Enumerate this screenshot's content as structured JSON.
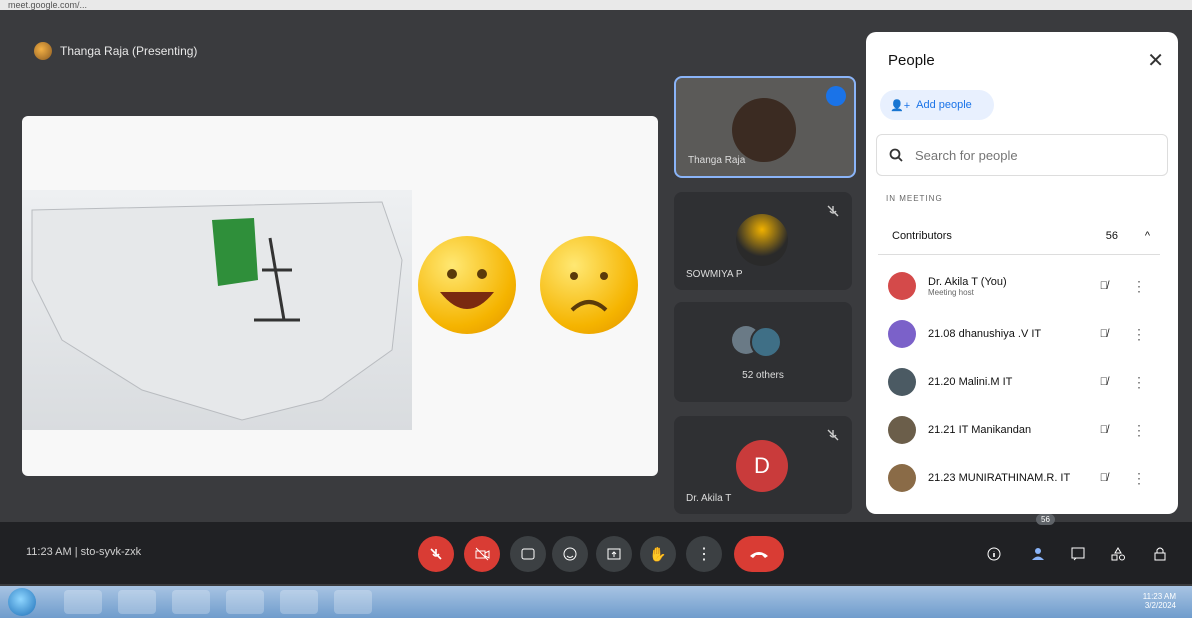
{
  "browser": {
    "url": "meet.google.com/..."
  },
  "meeting": {
    "presenter_label": "Thanga Raja (Presenting)",
    "time": "11:23 AM",
    "code": "sto-syvk-zxk"
  },
  "tiles": [
    {
      "name": "Thanga Raja"
    },
    {
      "name": "SOWMIYA P"
    },
    {
      "name": "52 others"
    },
    {
      "name": "Dr. Akila T",
      "initial": "D"
    }
  ],
  "people_panel": {
    "title": "People",
    "add_label": "Add people",
    "search_placeholder": "Search for people",
    "section_label": "IN MEETING",
    "contributors_label": "Contributors",
    "contributors_count": "56",
    "participants": [
      {
        "name": "Dr. Akila T (You)",
        "sub": "Meeting host",
        "avatar_color": "#d44a4a"
      },
      {
        "name": "21.08 dhanushiya .V IT",
        "sub": "",
        "avatar_color": "#7b61c9"
      },
      {
        "name": "21.20 Malini.M IT",
        "sub": "",
        "avatar_color": "#4b5a63"
      },
      {
        "name": "21.21 IT Manikandan",
        "sub": "",
        "avatar_color": "#6b5e4a"
      },
      {
        "name": "21.23 MUNIRATHINAM.R. IT",
        "sub": "",
        "avatar_color": "#8a6b47"
      }
    ]
  },
  "controls": {
    "people_badge": "56"
  },
  "taskbar": {
    "tray_time": "11:23 AM",
    "tray_date": "3/2/2024"
  },
  "icons": [
    "mic-off-icon",
    "camera-off-icon",
    "captions-icon",
    "emoji-icon",
    "present-icon",
    "raise-hand-icon",
    "more-vert-icon",
    "end-call-icon",
    "info-icon",
    "people-icon",
    "chat-icon",
    "activities-icon",
    "host-controls-icon"
  ],
  "colors": {
    "red": "#d93c34",
    "blue": "#1a73e8",
    "dark": "#202124"
  }
}
